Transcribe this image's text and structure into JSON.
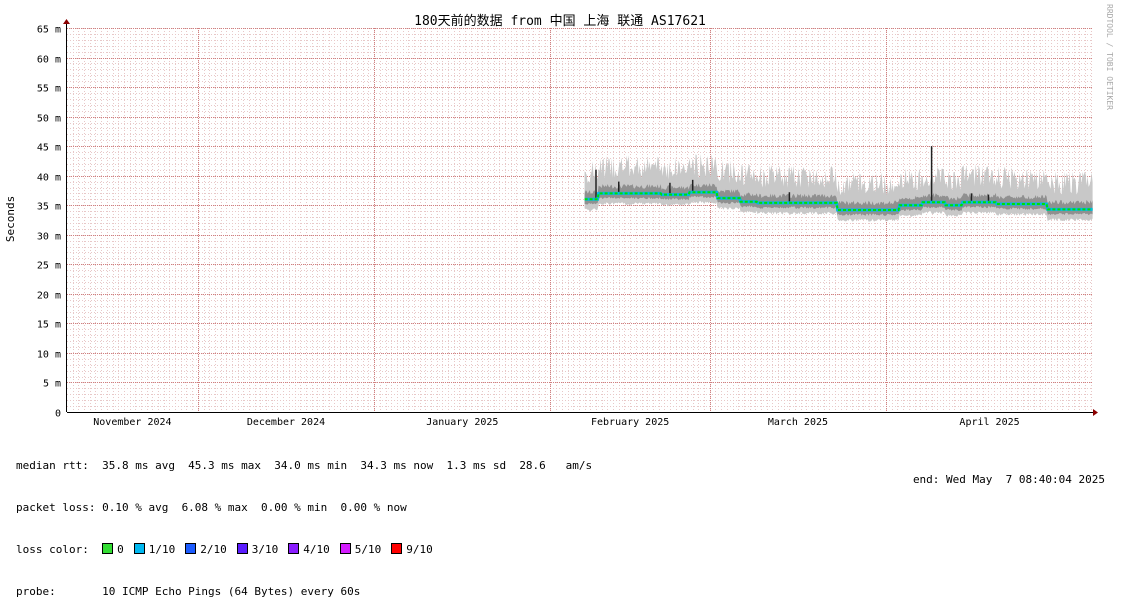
{
  "chart_data": {
    "type": "area",
    "title": "180天前的数据 from 中国 上海 联通 AS17621",
    "ylabel": "Seconds",
    "watermark": "RRDTOOL / TOBI OETIKER",
    "y_ticks": [
      "0",
      "5 m",
      "10 m",
      "15 m",
      "20 m",
      "25 m",
      "30 m",
      "35 m",
      "40 m",
      "45 m",
      "50 m",
      "55 m",
      "60 m",
      "65 m"
    ],
    "ylim": [
      0,
      0.065
    ],
    "x_domain": [
      "2024-11-08",
      "2025-05-07"
    ],
    "x_ticks": [
      {
        "label": "November 2024",
        "date": "2024-11-01"
      },
      {
        "label": "December 2024",
        "date": "2024-12-01"
      },
      {
        "label": "January 2025",
        "date": "2025-01-01"
      },
      {
        "label": "February 2025",
        "date": "2025-02-01"
      },
      {
        "label": "March 2025",
        "date": "2025-03-01"
      },
      {
        "label": "April 2025",
        "date": "2025-04-01"
      }
    ],
    "median_segments": [
      {
        "start": "2025-02-07",
        "end": "2025-02-09",
        "value": 0.036
      },
      {
        "start": "2025-02-09",
        "end": "2025-02-20",
        "value": 0.037
      },
      {
        "start": "2025-02-20",
        "end": "2025-02-25",
        "value": 0.0368
      },
      {
        "start": "2025-02-25",
        "end": "2025-03-02",
        "value": 0.0372
      },
      {
        "start": "2025-03-02",
        "end": "2025-03-06",
        "value": 0.0362
      },
      {
        "start": "2025-03-06",
        "end": "2025-03-09",
        "value": 0.0356
      },
      {
        "start": "2025-03-09",
        "end": "2025-03-23",
        "value": 0.0354
      },
      {
        "start": "2025-03-23",
        "end": "2025-04-03",
        "value": 0.0342
      },
      {
        "start": "2025-04-03",
        "end": "2025-04-07",
        "value": 0.035
      },
      {
        "start": "2025-04-07",
        "end": "2025-04-11",
        "value": 0.0355
      },
      {
        "start": "2025-04-11",
        "end": "2025-04-14",
        "value": 0.035
      },
      {
        "start": "2025-04-14",
        "end": "2025-04-20",
        "value": 0.0355
      },
      {
        "start": "2025-04-20",
        "end": "2025-04-29",
        "value": 0.0352
      },
      {
        "start": "2025-04-29",
        "end": "2025-05-07",
        "value": 0.0343
      }
    ],
    "spikes": [
      {
        "date": "2025-02-09",
        "value": 0.041
      },
      {
        "date": "2025-02-13",
        "value": 0.039
      },
      {
        "date": "2025-02-22",
        "value": 0.0388
      },
      {
        "date": "2025-02-26",
        "value": 0.0393
      },
      {
        "date": "2025-03-15",
        "value": 0.0372
      },
      {
        "date": "2025-04-09",
        "value": 0.045
      },
      {
        "date": "2025-04-16",
        "value": 0.037
      },
      {
        "date": "2025-04-19",
        "value": 0.0368
      }
    ],
    "colors": {
      "background": "#ffffff",
      "grid_minor": "#e8c8c8",
      "grid_major": "#d08080",
      "smoke_outer": "#c8c8c8",
      "smoke_inner": "#909090",
      "median_line": "#00e000",
      "median_alt": "#00b8e8",
      "axis": "#000000",
      "arrow": "#8b0000",
      "watermark": "#aaaaaa"
    }
  },
  "legend": {
    "median_rtt": "median rtt:  35.8 ms avg  45.3 ms max  34.0 ms min  34.3 ms now  1.3 ms sd  28.6   am/s",
    "packet_loss": "packet loss: 0.10 % avg  6.08 % max  0.00 % min  0.00 % now",
    "loss_label": "loss color:  ",
    "loss_colors": [
      {
        "label": "0",
        "color": "#33dd33"
      },
      {
        "label": "1/10",
        "color": "#00b8f0"
      },
      {
        "label": "2/10",
        "color": "#1c5cff"
      },
      {
        "label": "3/10",
        "color": "#5a1cff"
      },
      {
        "label": "4/10",
        "color": "#8a1cff"
      },
      {
        "label": "5/10",
        "color": "#d41cff"
      },
      {
        "label": "9/10",
        "color": "#ff0000"
      }
    ],
    "probe": "probe:       10 ICMP Echo Pings (64 Bytes) every 60s",
    "end": "end: Wed May  7 08:40:04 2025"
  }
}
